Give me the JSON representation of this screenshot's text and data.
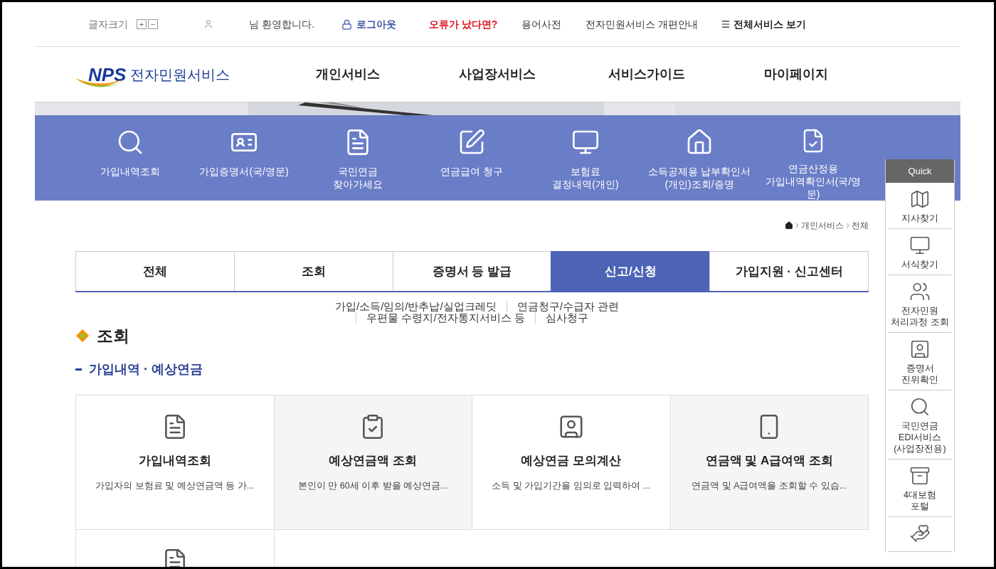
{
  "top_bar": {
    "font_size_label": "글자크기",
    "font_size_buttons": [
      "+",
      "−"
    ],
    "welcome": "님 환영합니다.",
    "logout": "로그아웃",
    "links": [
      {
        "label": "오류가 났다면?",
        "kind": "alert"
      },
      {
        "label": "용어사전",
        "kind": "plain"
      },
      {
        "label": "전자민원서비스 개편안내",
        "kind": "plain"
      }
    ],
    "all_services": "전체서비스 보기"
  },
  "logo": {
    "mark": "NPS",
    "title": "전자민원서비스"
  },
  "main_nav": [
    "개인서비스",
    "사업장서비스",
    "서비스가이드",
    "마이페이지"
  ],
  "shortcuts": [
    {
      "kind": "search",
      "label": "가입내역조회"
    },
    {
      "kind": "idcard",
      "label": "가입증명서(국/영문)"
    },
    {
      "kind": "document",
      "label": "국민연금\n찾아가세요"
    },
    {
      "kind": "edit",
      "label": "연금급여 청구"
    },
    {
      "kind": "monitor",
      "label": "보험료\n결정내역(개인)"
    },
    {
      "kind": "house",
      "label": "소득공제용 납부확인서\n(개인)조회/증명"
    },
    {
      "kind": "certificate",
      "label": "연금산정용\n가입내역확인서(국/영\n문)"
    }
  ],
  "breadcrumb": [
    "개인서비스",
    "전체"
  ],
  "tabs": [
    {
      "label": "전체",
      "selected": false
    },
    {
      "label": "조회",
      "selected": false
    },
    {
      "label": "증명서 등 발급",
      "selected": false
    },
    {
      "label": "신고/신청",
      "selected": true
    },
    {
      "label": "가입지원 · 신고센터",
      "selected": false
    }
  ],
  "sub_tabs": [
    "가입/소득/임의/반추납/실업크레딧",
    "연금청구/수급자 관련",
    "우편물 수령지/전자통지서비스 등",
    "심사청구"
  ],
  "section_title": "조회",
  "subsection_title": "가입내역 · 예상연금",
  "cards": [
    {
      "kind": "search",
      "title": "가입내역조회",
      "description": "가입자의 보험료 및 예상연금액 등 가..."
    },
    {
      "kind": "check",
      "title": "예상연금액 조회",
      "description": "본인이 만 60세 이후 받을 예상연금..."
    },
    {
      "kind": "person",
      "title": "예상연금 모의계산",
      "description": "소득 및 가입기간을 임의로 입력하여 ..."
    },
    {
      "kind": "phone",
      "title": "연금액 및 A급여액 조회",
      "description": "연금액 및 A급여액을 조회할 수 있습..."
    },
    {
      "kind": "search"
    }
  ],
  "quick": {
    "title": "Quick",
    "items": [
      {
        "kind": "map",
        "label": "지사찾기"
      },
      {
        "kind": "monitor",
        "label": "서식찾기"
      },
      {
        "kind": "people",
        "label": "전자민원\n처리과정 조회"
      },
      {
        "kind": "certificate",
        "label": "증명서\n진위확인"
      },
      {
        "kind": "edi",
        "label": "국민연금\nEDI서비스\n(사업장전용)"
      },
      {
        "kind": "box",
        "label": "4대보험\n포털"
      },
      {
        "kind": "hand"
      }
    ]
  }
}
